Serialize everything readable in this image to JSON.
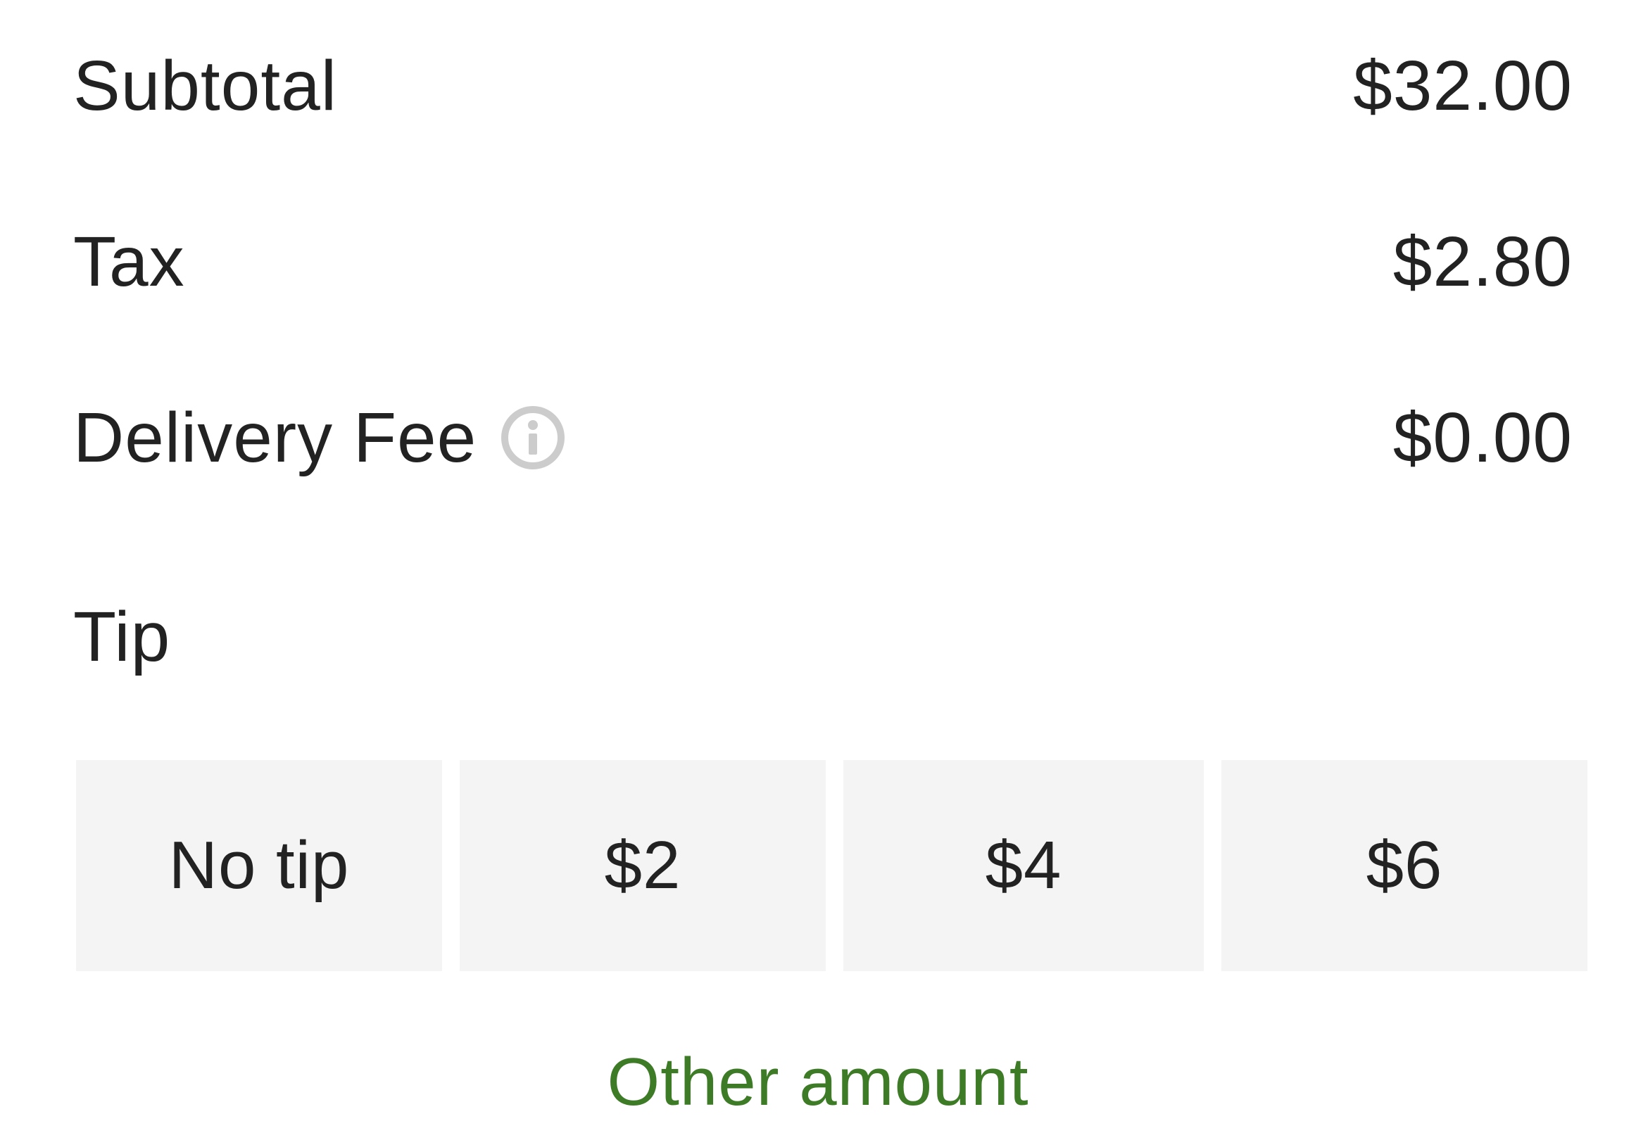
{
  "summary": {
    "subtotal": {
      "label": "Subtotal",
      "value": "$32.00"
    },
    "tax": {
      "label": "Tax",
      "value": "$2.80"
    },
    "delivery_fee": {
      "label": "Delivery Fee",
      "value": "$0.00",
      "icon": "info-icon"
    }
  },
  "tip": {
    "label": "Tip",
    "options": [
      {
        "label": "No tip"
      },
      {
        "label": "$2"
      },
      {
        "label": "$4"
      },
      {
        "label": "$6"
      }
    ],
    "other_amount_label": "Other amount"
  },
  "colors": {
    "text": "#222222",
    "button_bg": "#f4f4f4",
    "accent_green": "#3e7b27",
    "icon_gray": "#cccccc"
  }
}
